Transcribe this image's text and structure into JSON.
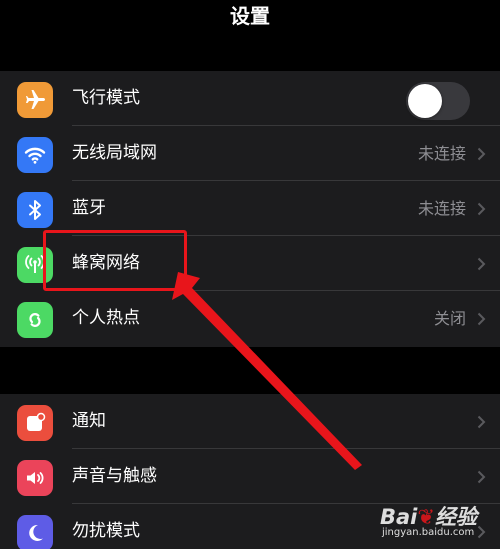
{
  "header": {
    "title": "设置"
  },
  "group1": {
    "items": [
      {
        "label": "飞行模式",
        "icon": "airplane-icon",
        "color": "#f09a37",
        "toggle": {
          "on": false
        }
      },
      {
        "label": "无线局域网",
        "icon": "wifi-icon",
        "color": "#3478f6",
        "value": "未连接"
      },
      {
        "label": "蓝牙",
        "icon": "bluetooth-icon",
        "color": "#3478f6",
        "value": "未连接"
      },
      {
        "label": "蜂窝网络",
        "icon": "cellular-antenna-icon",
        "color": "#4cd964"
      },
      {
        "label": "个人热点",
        "icon": "hotspot-link-icon",
        "color": "#4cd964",
        "value": "关闭"
      }
    ]
  },
  "group2": {
    "items": [
      {
        "label": "通知",
        "icon": "notifications-icon",
        "color": "#eb4e3d"
      },
      {
        "label": "声音与触感",
        "icon": "speaker-icon",
        "color": "#eb445a"
      },
      {
        "label": "勿扰模式",
        "icon": "moon-icon",
        "color": "#5e5ce6"
      }
    ]
  },
  "annotation": {
    "highlight_color": "#e8151b"
  },
  "watermark": {
    "brand": "Bai",
    "brand_suffix": "经验",
    "url": "jingyan.baidu.com"
  }
}
